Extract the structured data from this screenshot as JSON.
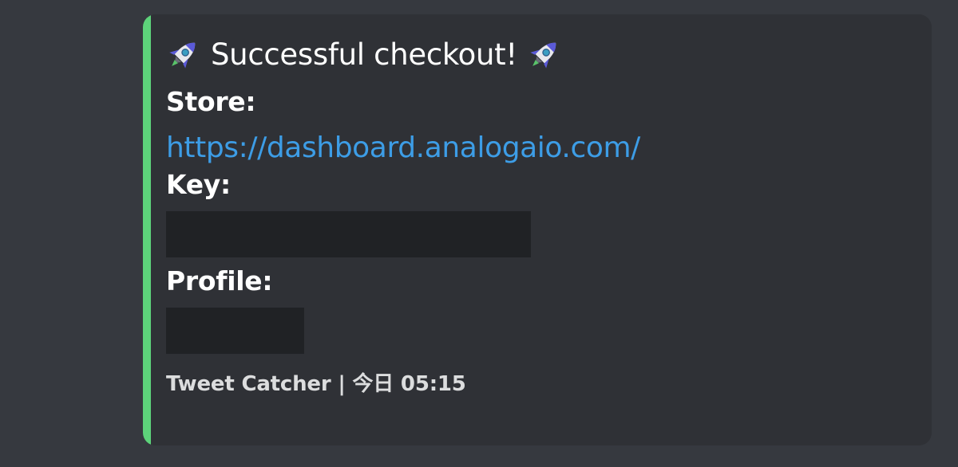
{
  "embed": {
    "accent_color": "#5dd37a",
    "title_icon_left": "rocket-icon",
    "title_text": "Successful checkout!",
    "title_icon_right": "rocket-icon",
    "fields": [
      {
        "name": "Store:",
        "value": "https://dashboard.analogaio.com/",
        "value_type": "link"
      },
      {
        "name": "Key:",
        "value_type": "redacted"
      },
      {
        "name": "Profile:",
        "value_type": "redacted"
      }
    ],
    "footer_text": "Tweet Catcher | 今日 05:15"
  }
}
